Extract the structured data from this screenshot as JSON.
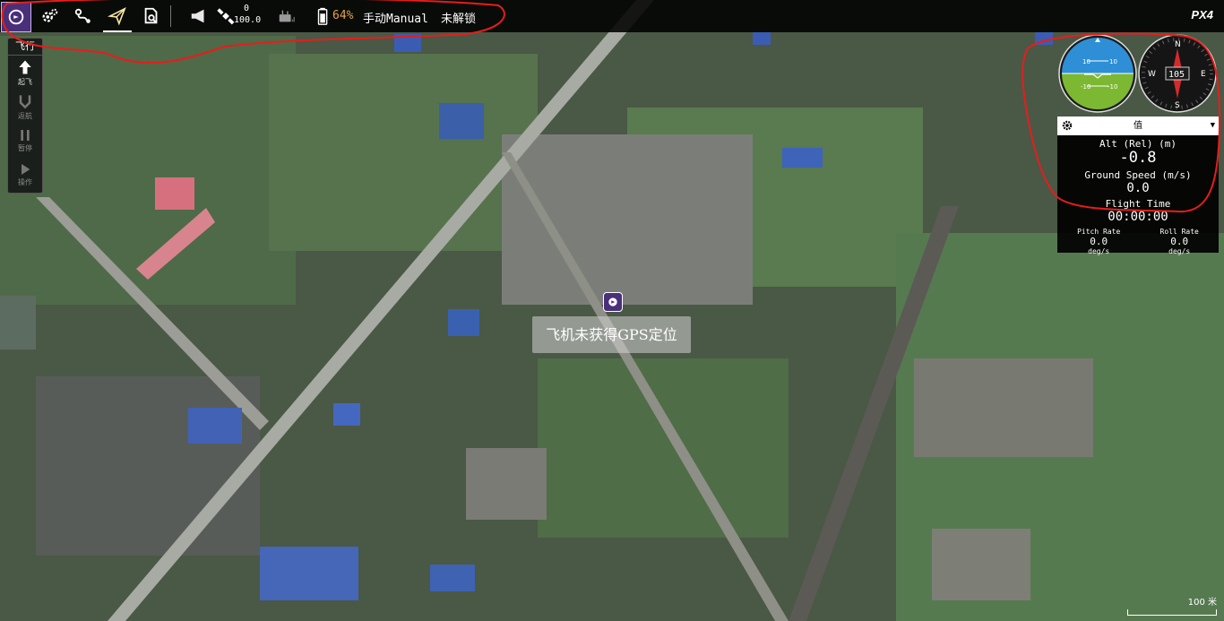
{
  "toolbar": {
    "icons": [
      "app-logo-icon",
      "settings-gear-icon",
      "plan-route-icon",
      "fly-paper-plane-icon",
      "analyze-doc-icon"
    ],
    "messages_icon": "megaphone-icon",
    "gps_icon": "satellite-icon",
    "gps_count": "0",
    "gps_hdop": "100.0",
    "rc_icon": "remote-control-icon",
    "battery_icon": "battery-icon",
    "battery_percent": "64%",
    "flight_mode": "手动Manual",
    "arm_status": "未解锁",
    "brand": "PX4"
  },
  "flybar": {
    "title": "飞行",
    "buttons": [
      {
        "label": "起飞",
        "icon": "takeoff-arrow-icon",
        "enabled": true
      },
      {
        "label": "返航",
        "icon": "return-icon",
        "enabled": false
      },
      {
        "label": "暂停",
        "icon": "pause-icon",
        "enabled": false
      },
      {
        "label": "操作",
        "icon": "play-icon",
        "enabled": false
      }
    ]
  },
  "map": {
    "gps_message": "飞机未获得GPS定位",
    "scale_label": "100 米"
  },
  "instruments": {
    "attitude_marks": [
      "10",
      "10",
      "-10",
      "-10"
    ],
    "compass_heading": "105",
    "compass_labels": {
      "n": "N",
      "e": "E",
      "s": "S",
      "w": "W"
    }
  },
  "values_panel": {
    "header_label": "值",
    "alt_label": "Alt (Rel) (m)",
    "alt_value": "-0.8",
    "ground_speed_label": "Ground Speed (m/s)",
    "ground_speed_value": "0.0",
    "flight_time_label": "Flight Time",
    "flight_time_value": "00:00:00",
    "pitch_rate_label": "Pitch Rate",
    "pitch_rate_value": "0.0",
    "pitch_rate_unit": "deg/s",
    "roll_rate_label": "Roll Rate",
    "roll_rate_value": "0.0",
    "roll_rate_unit": "deg/s"
  },
  "colors": {
    "accent": "#4a2f7a",
    "battery": "#e8a33d",
    "annotation": "#e81c1c",
    "sky": "#2e8fd6",
    "ground": "#7cb832"
  }
}
